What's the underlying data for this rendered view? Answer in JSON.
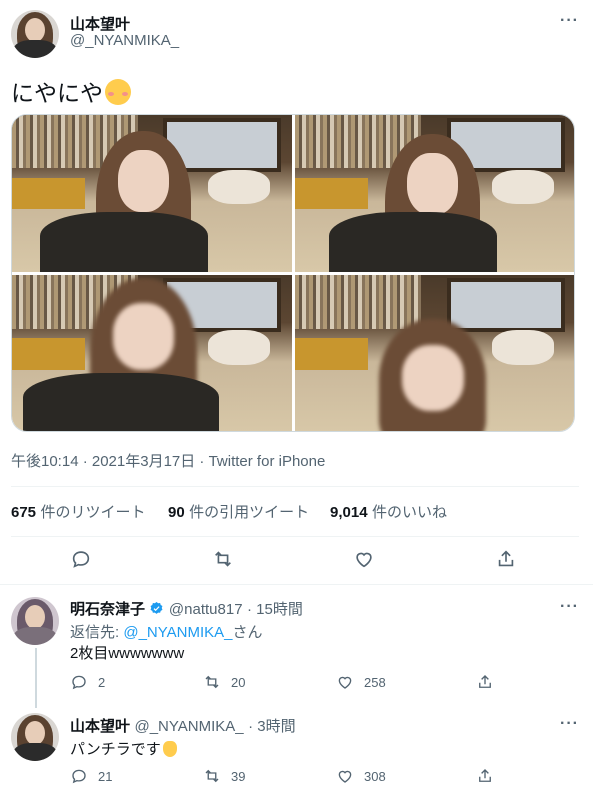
{
  "tweet": {
    "author_name": "山本望叶",
    "author_handle": "@_NYANMIKA_",
    "text": "にやにや",
    "emoji": "smiling-face-with-smiling-eyes",
    "timestamp": "午後10:14 · 2021年3月17日 · Twitter for iPhone",
    "stats": {
      "retweets_count": "675",
      "retweets_label": "件のリツイート",
      "quotes_count": "90",
      "quotes_label": "件の引用ツイート",
      "likes_count": "9,014",
      "likes_label": "件のいいね"
    },
    "photos_count": 4
  },
  "icons": [
    "more-icon",
    "reply-icon",
    "retweet-icon",
    "like-icon",
    "share-icon",
    "verified-badge-icon"
  ],
  "replies": [
    {
      "author_name": "明石奈津子",
      "verified": true,
      "author_handle": "@nattu817",
      "time": "· 15時間",
      "reply_to_prefix": "返信先: ",
      "reply_to_handle": "@_NYANMIKA_",
      "reply_to_suffix": "さん",
      "text": "2枚目wwwwwww",
      "reply_count": "2",
      "retweet_count": "20",
      "like_count": "258"
    },
    {
      "author_name": "山本望叶",
      "author_handle": "@_NYANMIKA_",
      "time": "· 3時間",
      "text": "パンチラです",
      "emoji": "raised-hand",
      "reply_count": "21",
      "retweet_count": "39",
      "like_count": "308"
    }
  ],
  "colors": {
    "text_primary": "#0f1419",
    "text_secondary": "#536471",
    "link": "#1d9bf0",
    "divider": "#eff3f4",
    "verified": "#1d9bf0"
  }
}
